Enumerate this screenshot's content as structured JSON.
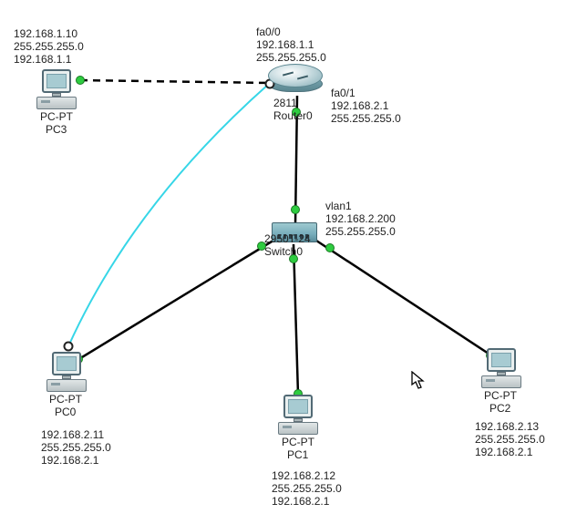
{
  "nodes": {
    "router0": {
      "model": "2811",
      "name": "Router0",
      "interfaces": [
        {
          "if": "fa0/0",
          "ip": "192.168.1.1",
          "mask": "255.255.255.0"
        },
        {
          "if": "fa0/1",
          "ip": "192.168.2.1",
          "mask": "255.255.255.0"
        }
      ]
    },
    "switch0": {
      "model": "2950T-24",
      "name": "Switch0",
      "vlan_label": "vlan1",
      "ip": "192.168.2.200",
      "mask": "255.255.255.0"
    },
    "pc0": {
      "model": "PC-PT",
      "name": "PC0",
      "ip": "192.168.2.11",
      "mask": "255.255.255.0",
      "gateway": "192.168.2.1"
    },
    "pc1": {
      "model": "PC-PT",
      "name": "PC1",
      "ip": "192.168.2.12",
      "mask": "255.255.255.0",
      "gateway": "192.168.2.1"
    },
    "pc2": {
      "model": "PC-PT",
      "name": "PC2",
      "ip": "192.168.2.13",
      "mask": "255.255.255.0",
      "gateway": "192.168.2.1"
    },
    "pc3": {
      "model": "PC-PT",
      "name": "PC3",
      "ip": "192.168.1.10",
      "mask": "255.255.255.0",
      "gateway": "192.168.1.1"
    }
  },
  "links": [
    {
      "a": "pc3",
      "b": "router0",
      "type": "dashed"
    },
    {
      "a": "router0",
      "b": "switch0",
      "type": "solid"
    },
    {
      "a": "switch0",
      "b": "pc0",
      "type": "solid"
    },
    {
      "a": "switch0",
      "b": "pc1",
      "type": "solid"
    },
    {
      "a": "switch0",
      "b": "pc2",
      "type": "solid"
    },
    {
      "a": "router0",
      "b": "pc0",
      "type": "console"
    }
  ],
  "colors": {
    "link_solid": "#000000",
    "link_dashed": "#000000",
    "link_console": "#36d6e7",
    "port_up": "#2ecc40"
  }
}
